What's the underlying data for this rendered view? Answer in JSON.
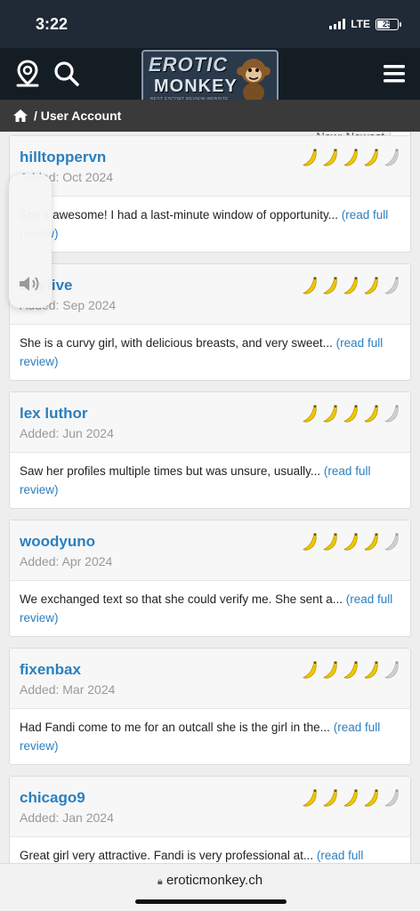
{
  "status_bar": {
    "time": "3:22",
    "network": "LTE",
    "battery": "25"
  },
  "brand": {
    "line1": "EROTIC",
    "line2": "MONKEY",
    "tagline": "BEST ESCORT REVIEW WEBSITE"
  },
  "breadcrumb": {
    "label": "/ User Account"
  },
  "sort": {
    "label": "New: Newest"
  },
  "reviews": [
    {
      "reviewer": "hilltoppervn",
      "added": "Added: Oct 2024",
      "excerpt": "She's awesome! I had a last-minute window of opportunity...",
      "read_more": "(read full review)",
      "rating": 4
    },
    {
      "reviewer": "boyfive",
      "added": "Added: Sep 2024",
      "excerpt": "She is a curvy girl, with delicious breasts, and very sweet...",
      "read_more": "(read full review)",
      "rating": 4
    },
    {
      "reviewer": "lex luthor",
      "added": "Added: Jun 2024",
      "excerpt": "Saw her profiles multiple times but was unsure, usually...",
      "read_more": "(read full review)",
      "rating": 4
    },
    {
      "reviewer": "woodyuno",
      "added": "Added: Apr 2024",
      "excerpt": "We exchanged text so that she could verify me. She sent a...",
      "read_more": "(read full review)",
      "rating": 4
    },
    {
      "reviewer": "fixenbax",
      "added": "Added: Mar 2024",
      "excerpt": "Had Fandi come to me for an outcall she is the girl in the...",
      "read_more": "(read full review)",
      "rating": 4
    },
    {
      "reviewer": "chicago9",
      "added": "Added: Jan 2024",
      "excerpt": "Great girl very attractive. Fandi is very professional at...",
      "read_more": "(read full review)",
      "rating": 4
    }
  ],
  "url_bar": {
    "domain": "eroticmonkey.ch"
  },
  "colors": {
    "link": "#2b7fbf",
    "banana": "#f2c800",
    "banana_empty": "#d0d0d0",
    "header": "#141c24"
  }
}
